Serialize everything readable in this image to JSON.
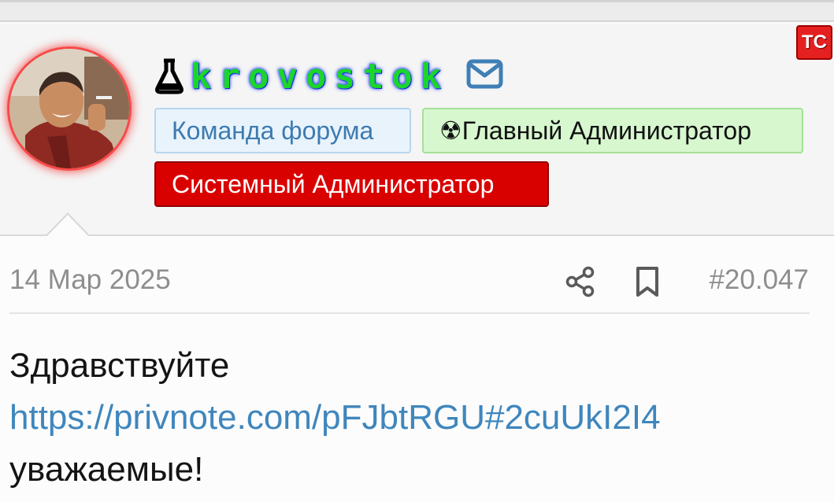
{
  "post": {
    "author": {
      "username": "krovostok",
      "badges": {
        "team": "Команда форума",
        "main_admin": "☢Главный Администратор",
        "system_admin": "Системный Администратор"
      },
      "ts_badge": "ТС"
    },
    "meta": {
      "date": "14 Мар 2025",
      "number": "#20.047"
    },
    "content": {
      "greeting": "Здравствуйте",
      "link": "https://privnote.com/pFJbtRGU#2cuUkI2I4",
      "closing": "уважаемые!"
    }
  },
  "colors": {
    "username": "#1bd62a",
    "username_glow": "#2340ff",
    "system_admin_badge": "#d90000",
    "main_admin_badge": "#d7f7cf",
    "team_badge": "#e8f3fc",
    "link": "#3f86bd"
  },
  "icons": [
    "flask-icon",
    "mail-icon",
    "share-icon",
    "bookmark-icon"
  ]
}
